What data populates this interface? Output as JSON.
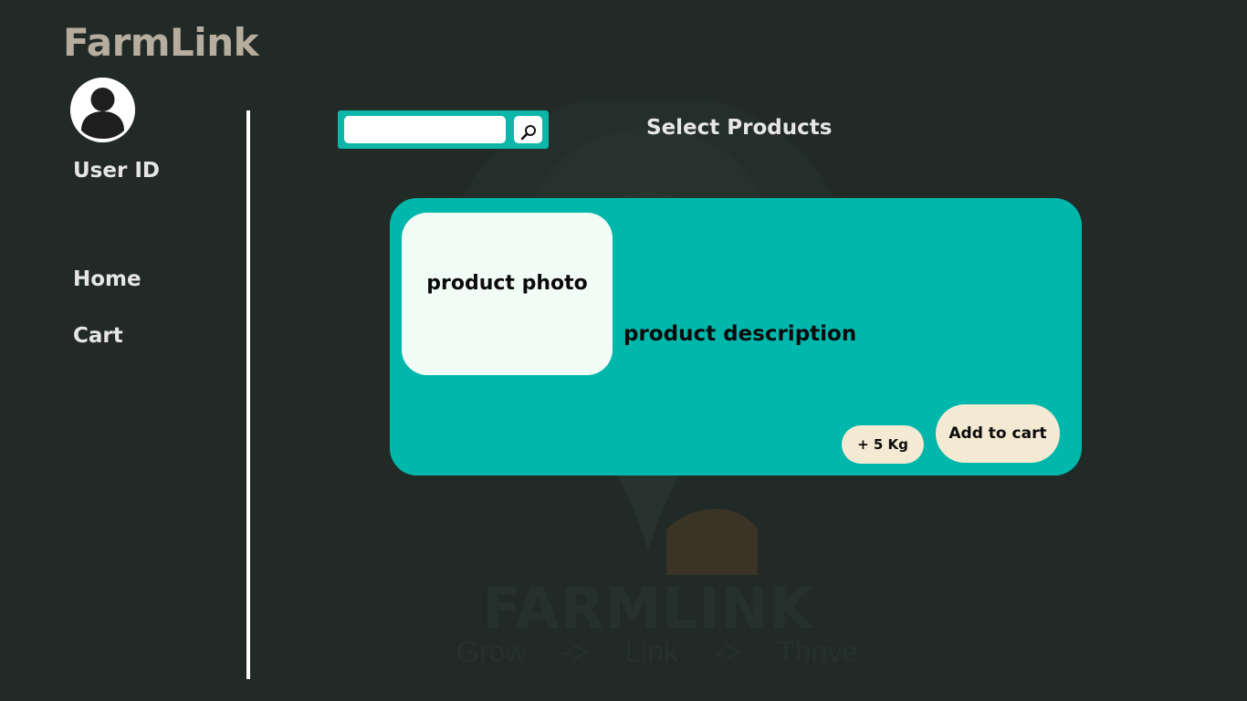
{
  "app": {
    "brand": "FarmLink"
  },
  "sidebar": {
    "user_label": "User ID",
    "items": [
      {
        "label": "Home"
      },
      {
        "label": "Cart"
      }
    ]
  },
  "search": {
    "value": "",
    "placeholder": ""
  },
  "main": {
    "title": "Select Products"
  },
  "product": {
    "photo_label": "product photo",
    "description": "product description",
    "quantity_label": "+ 5 Kg",
    "add_to_cart_label": "Add to cart"
  },
  "watermark": {
    "name": "FARMLINK",
    "tagline": [
      "Grow",
      "->",
      "Link",
      "->",
      "Thrive"
    ]
  },
  "colors": {
    "background": "#212a27",
    "accent": "#00b7ab",
    "brand_text": "#b7ad9f",
    "button_cream": "#f4ead3",
    "photo_bg": "#f2fcf7"
  },
  "icons": {
    "avatar": "user-silhouette-icon",
    "search": "magnifier-icon",
    "watermark": "location-pin-logo"
  }
}
